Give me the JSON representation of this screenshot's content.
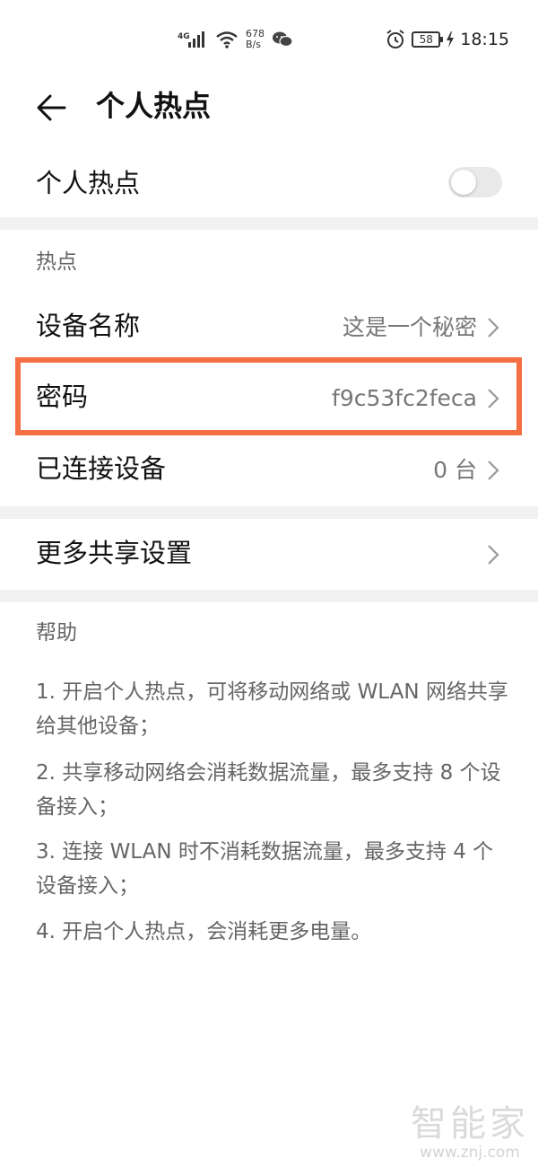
{
  "status_bar": {
    "network": "4G",
    "speed_value": "678",
    "speed_unit": "B/s",
    "battery": "58",
    "time": "18:15"
  },
  "header": {
    "title": "个人热点"
  },
  "hotspot_toggle": {
    "label": "个人热点",
    "enabled": false
  },
  "hotspot_section": {
    "title": "热点",
    "device_name_label": "设备名称",
    "device_name_value": "这是一个秘密",
    "password_label": "密码",
    "password_value": "f9c53fc2feca",
    "connected_label": "已连接设备",
    "connected_value": "0 台"
  },
  "more_sharing": {
    "label": "更多共享设置"
  },
  "help": {
    "title": "帮助",
    "items": [
      "1. 开启个人热点，可将移动网络或 WLAN 网络共享给其他设备；",
      "2. 共享移动网络会消耗数据流量，最多支持 8 个设备接入；",
      "3. 连接 WLAN 时不消耗数据流量，最多支持 4 个设备接入；",
      "4. 开启个人热点，会消耗更多电量。"
    ]
  },
  "watermark": {
    "name": "智能家",
    "url": "www.znj.com"
  },
  "colors": {
    "highlight": "#f46f44",
    "divider": "#f1f1f1"
  }
}
